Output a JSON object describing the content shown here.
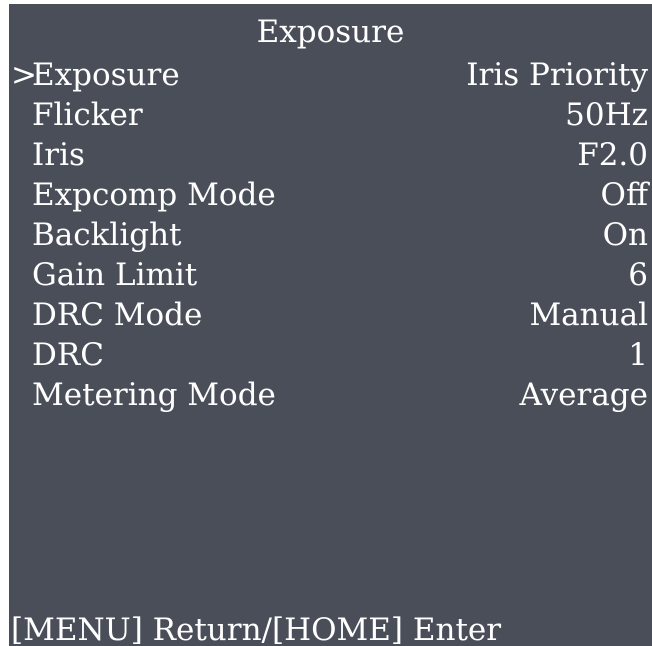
{
  "title": "Exposure",
  "cursor": ">",
  "items": [
    {
      "label": "Exposure",
      "value": "Iris Priority"
    },
    {
      "label": "Flicker",
      "value": "50Hz"
    },
    {
      "label": "Iris",
      "value": "F2.0"
    },
    {
      "label": "Expcomp Mode",
      "value": "Off"
    },
    {
      "label": "Backlight",
      "value": "On"
    },
    {
      "label": "Gain Limit",
      "value": "6"
    },
    {
      "label": "DRC Mode",
      "value": "Manual"
    },
    {
      "label": "DRC",
      "value": "1"
    },
    {
      "label": "Metering Mode",
      "value": "Average"
    }
  ],
  "footer": "[MENU] Return/[HOME] Enter",
  "colors": {
    "background": "#4a4e58",
    "text": "#ffffff"
  }
}
